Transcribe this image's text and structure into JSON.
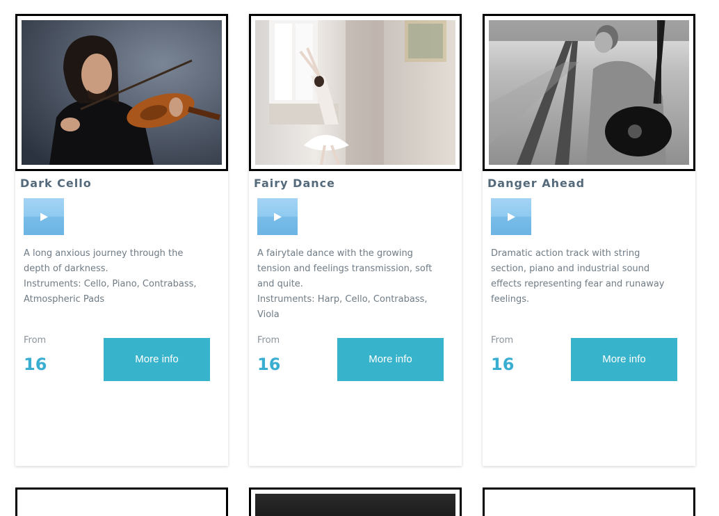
{
  "cards": [
    {
      "title": "Dark Cello",
      "image_icon": "violinist-photo",
      "description_lines": [
        "A long anxious journey through the depth of darkness.",
        "Instruments: Cello, Piano, Contrabass, Atmospheric Pads"
      ],
      "from_label": "From",
      "price": "16",
      "button_label": "More info"
    },
    {
      "title": "Fairy Dance",
      "image_icon": "ballerina-photo",
      "description_lines": [
        "A fairytale dance with the growing tension and feelings transmission, soft and quite.",
        "Instruments: Harp, Cello, Contrabass, Viola"
      ],
      "from_label": "From",
      "price": "16",
      "button_label": "More info"
    },
    {
      "title": "Danger Ahead",
      "image_icon": "guitarist-railway-photo",
      "description_lines": [
        "Dramatic action track with string section, piano and industrial sound effects representing fear and runaway feelings."
      ],
      "from_label": "From",
      "price": "16",
      "button_label": "More info"
    }
  ],
  "colors": {
    "title": "#546a7b",
    "price": "#3aaed1",
    "button": "#38b3cc",
    "play_button": "#8ecaf0"
  }
}
